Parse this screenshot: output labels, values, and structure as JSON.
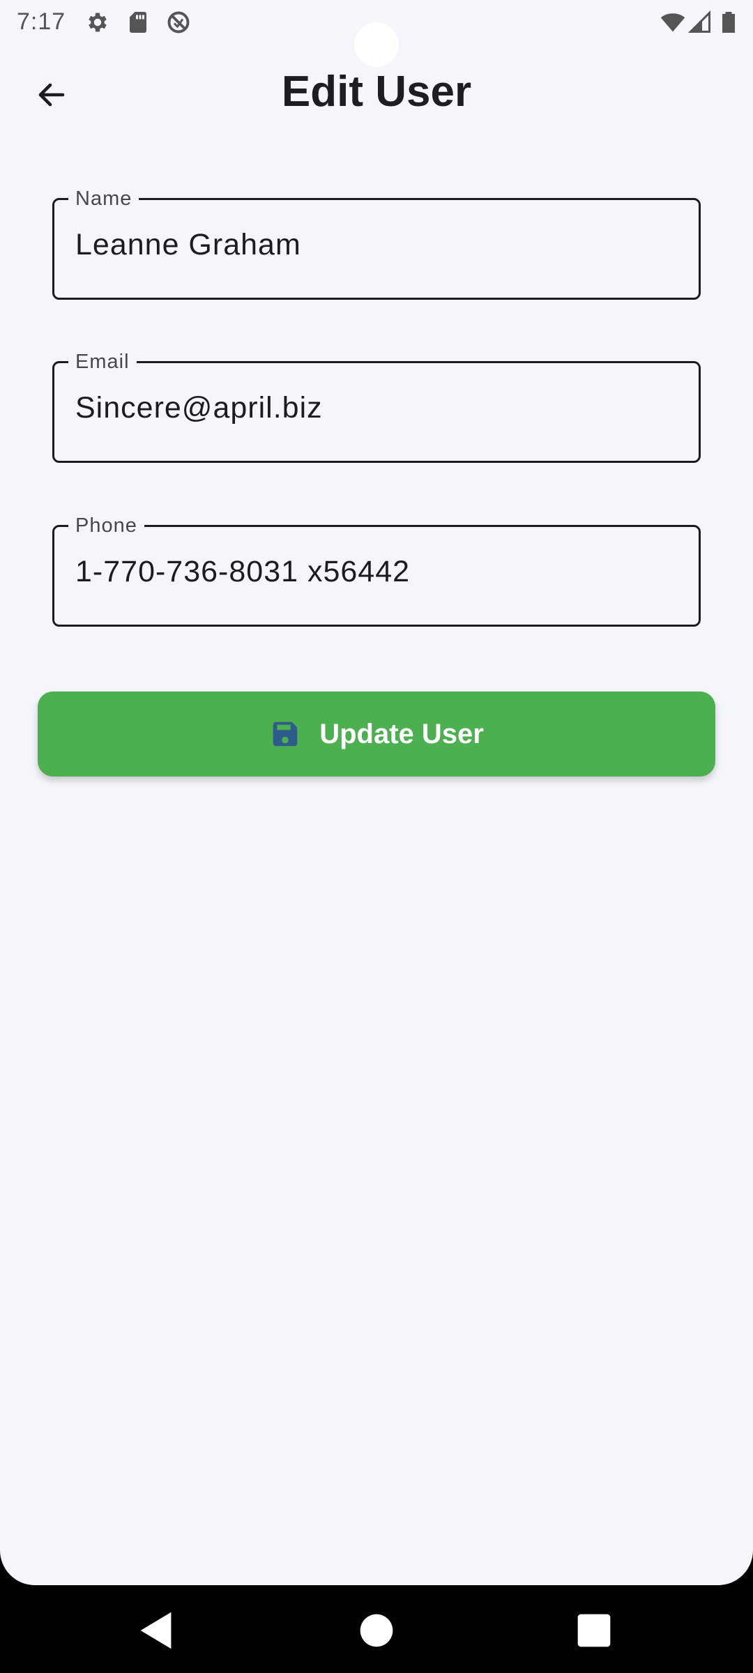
{
  "status_bar": {
    "time": "7:17",
    "left_icons": [
      "settings-icon",
      "sd-card-icon",
      "do-not-disturb-icon"
    ],
    "right_icons": [
      "wifi-icon",
      "cellular-signal-icon",
      "battery-icon"
    ]
  },
  "app_bar": {
    "back_icon": "arrow-left-icon",
    "title": "Edit User"
  },
  "form": {
    "name": {
      "label": "Name",
      "value": "Leanne Graham"
    },
    "email": {
      "label": "Email",
      "value": "Sincere@april.biz"
    },
    "phone": {
      "label": "Phone",
      "value": "1-770-736-8031 x56442"
    }
  },
  "update_button": {
    "icon": "save-icon",
    "label": "Update User",
    "color": "#4caf50",
    "icon_color": "#2f5c8a"
  },
  "nav_bar": {
    "buttons": [
      "back-triangle-icon",
      "home-circle-icon",
      "recents-square-icon"
    ]
  }
}
